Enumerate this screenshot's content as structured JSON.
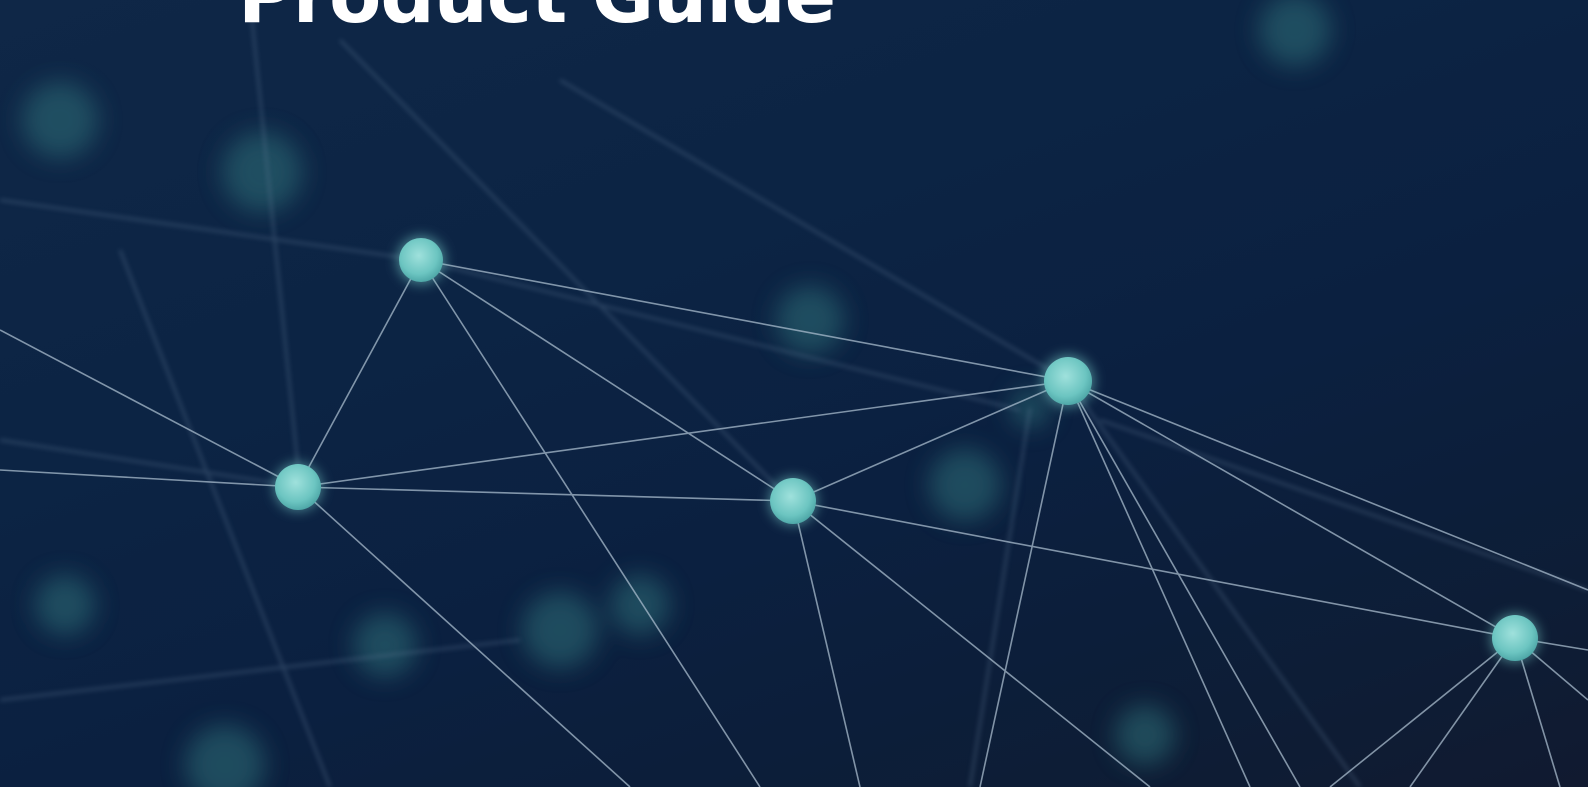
{
  "hero": {
    "title": "Product Guide",
    "background_color": "#0c2240",
    "accent_color": "#6fc7c3",
    "line_color": "#9fb4c6"
  }
}
